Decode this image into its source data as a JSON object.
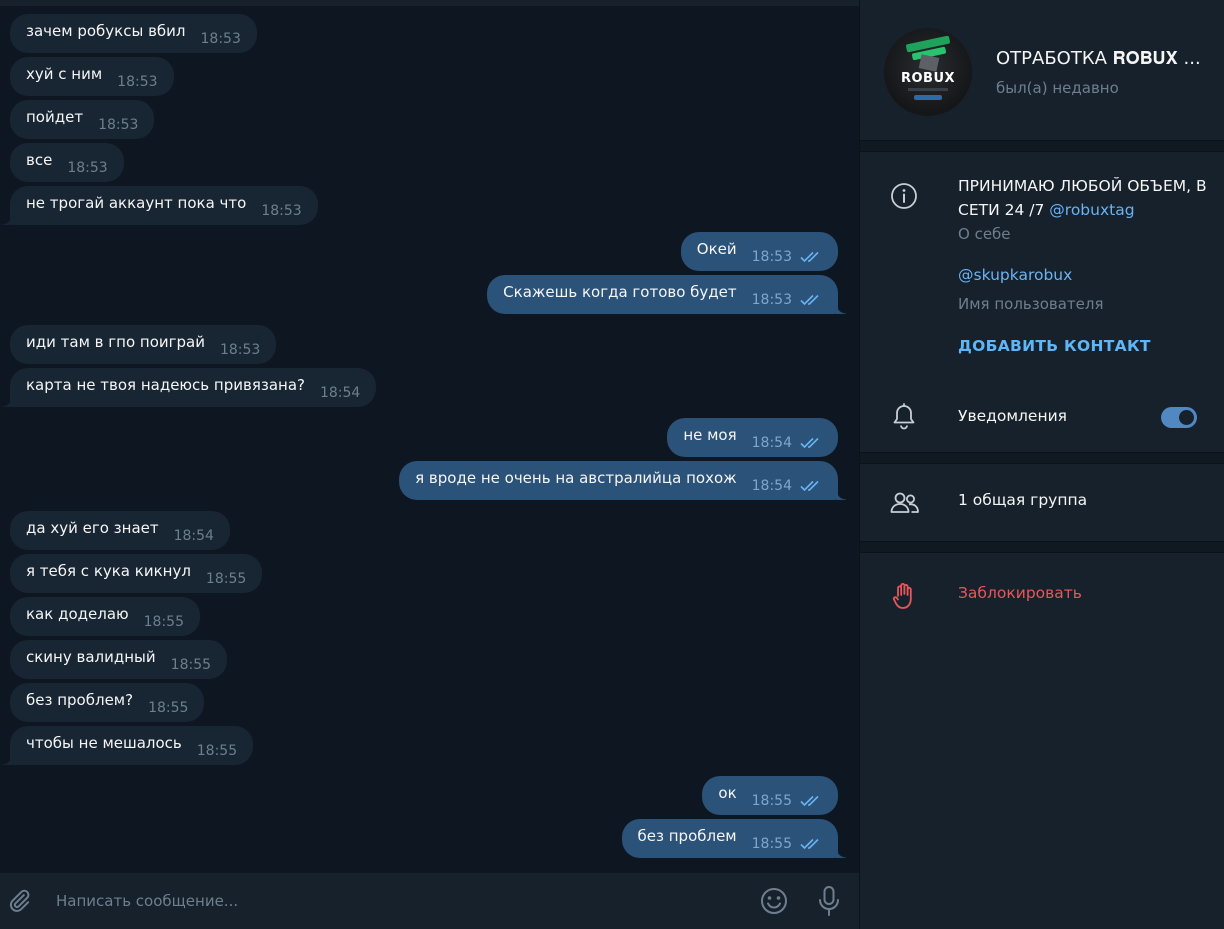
{
  "chat": {
    "messages": [
      {
        "dir": "in",
        "text": "зачем робуксы вбил",
        "time": "18:53"
      },
      {
        "dir": "in",
        "text": "хуй с ним",
        "time": "18:53"
      },
      {
        "dir": "in",
        "text": "пойдет",
        "time": "18:53"
      },
      {
        "dir": "in",
        "text": "все",
        "time": "18:53"
      },
      {
        "dir": "in",
        "text": "не трогай аккаунт пока что",
        "time": "18:53",
        "last": true
      },
      {
        "dir": "out",
        "text": "Окей",
        "time": "18:53"
      },
      {
        "dir": "out",
        "text": "Скажешь когда готово будет",
        "time": "18:53",
        "last": true
      },
      {
        "dir": "in",
        "text": "иди там в гпо поиграй",
        "time": "18:53"
      },
      {
        "dir": "in",
        "text": "карта не твоя надеюсь привязана?",
        "time": "18:54",
        "last": true
      },
      {
        "dir": "out",
        "text": "не моя",
        "time": "18:54"
      },
      {
        "dir": "out",
        "text": "я вроде не очень на австралийца похож",
        "time": "18:54",
        "last": true
      },
      {
        "dir": "in",
        "text": "да хуй его знает",
        "time": "18:54"
      },
      {
        "dir": "in",
        "text": "я тебя с кука кикнул",
        "time": "18:55"
      },
      {
        "dir": "in",
        "text": "как доделаю",
        "time": "18:55"
      },
      {
        "dir": "in",
        "text": "скину валидный",
        "time": "18:55"
      },
      {
        "dir": "in",
        "text": "без проблем?",
        "time": "18:55"
      },
      {
        "dir": "in",
        "text": "чтобы не мешалось",
        "time": "18:55",
        "last": true
      },
      {
        "dir": "out",
        "text": "ок",
        "time": "18:55"
      },
      {
        "dir": "out",
        "text": "без проблем",
        "time": "18:55",
        "last": true
      }
    ]
  },
  "composer": {
    "placeholder": "Написать сообщение..."
  },
  "profile": {
    "name": "ОТРАБОТКА 𝐑𝐎𝐁𝐔𝐗 ...",
    "status": "был(а) недавно",
    "avatar_text": "ROBUX",
    "bio_text": "ПРИНИМАЮ ЛЮБОЙ ОБЪЕМ, В СЕТИ 24 /7 ",
    "bio_link": "@robuxtag",
    "bio_label": "О себе",
    "username": "@skupkarobux",
    "username_label": "Имя пользователя",
    "add_contact": "ДОБАВИТЬ КОНТАКТ",
    "notifications_label": "Уведомления",
    "notifications_on": true,
    "groups_label": "1 общая группа",
    "block_label": "Заблокировать"
  },
  "colors": {
    "accent": "#5288c1",
    "link": "#6ab3f3",
    "danger": "#e5585b",
    "bubble_in": "#182533",
    "bubble_out": "#2b5278"
  },
  "icons": [
    "attach-icon",
    "emoji-icon",
    "microphone-icon",
    "info-icon",
    "bell-icon",
    "group-icon",
    "hand-stop-icon",
    "double-check-icon"
  ]
}
